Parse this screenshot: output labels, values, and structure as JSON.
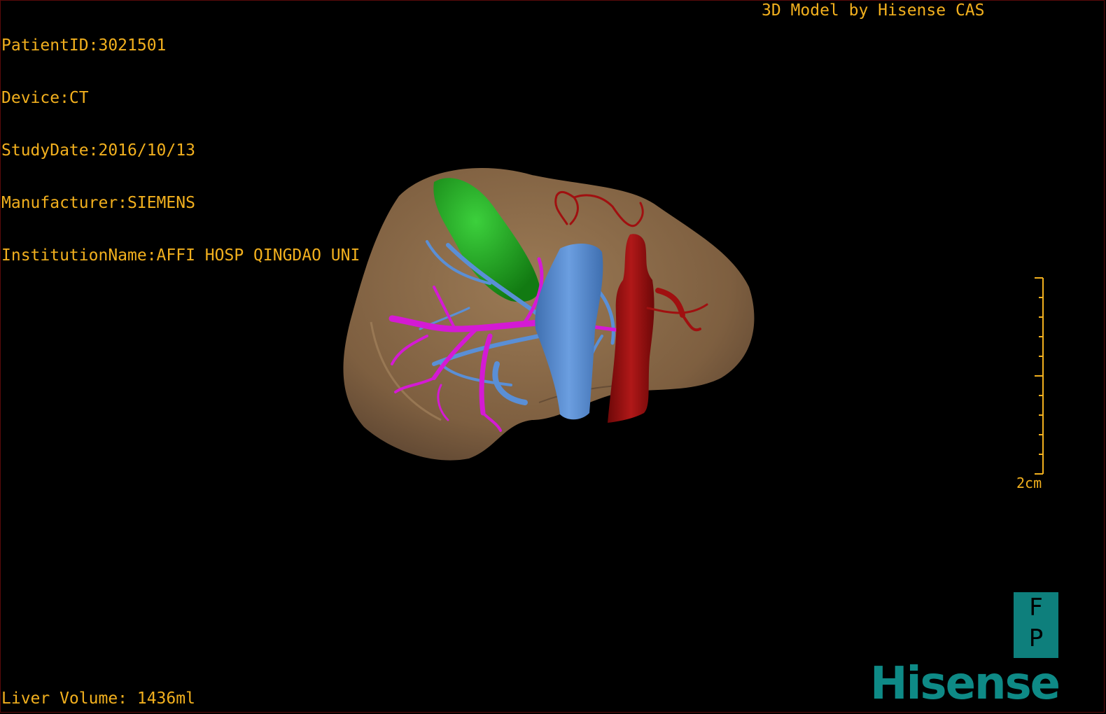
{
  "header": {
    "info_lines": [
      "PatientID:3021501",
      "Device:CT",
      "StudyDate:2016/10/13",
      "Manufacturer:SIEMENS",
      "InstitutionName:AFFI HOSP QINGDAO UNI"
    ],
    "model_title": "3D Model by Hisense CAS"
  },
  "footer": {
    "liver_volume": "Liver Volume: 1436ml"
  },
  "scale": {
    "label": "2cm"
  },
  "orientation": {
    "letters": [
      "F",
      "P"
    ]
  },
  "branding": {
    "logo_text": "Hisense"
  },
  "colors": {
    "overlay_text": "#f2b01e",
    "liver": "#8a6a48",
    "gallbladder": "#1fa01f",
    "portal_vein": "#d41ad4",
    "hepatic_vein": "#5a8fd6",
    "vena_cava": "#5a8fd6",
    "aorta": "#a01010",
    "logo": "#0e8a86"
  }
}
